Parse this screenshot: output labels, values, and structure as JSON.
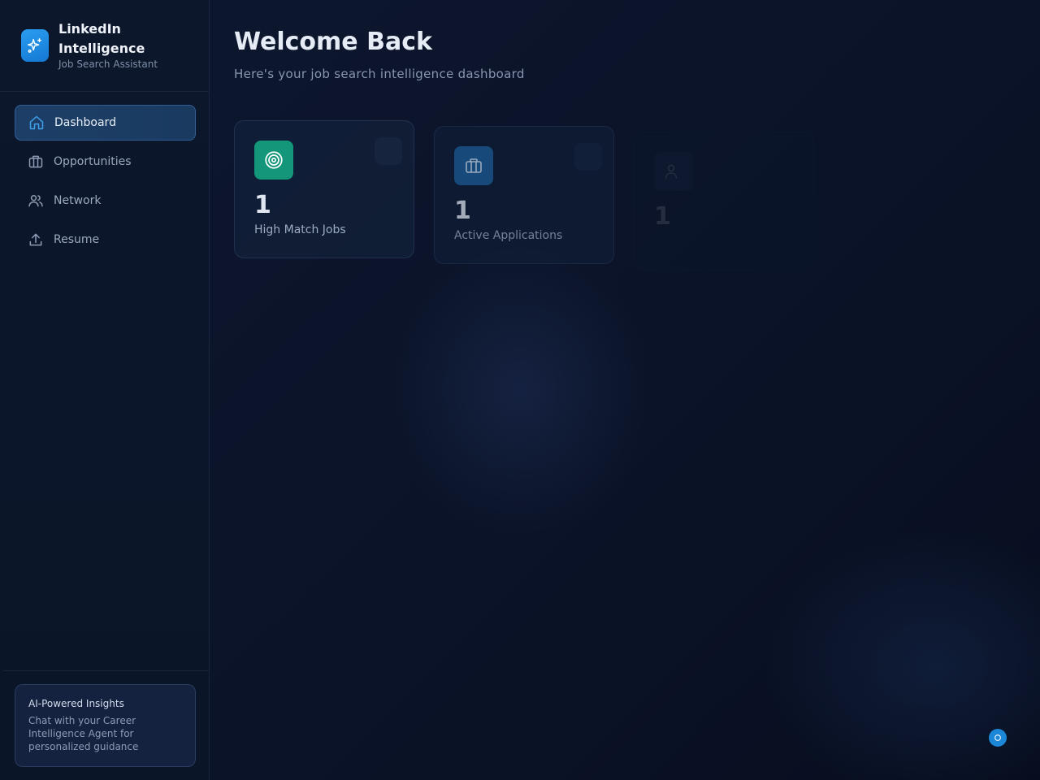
{
  "brand": {
    "title": "LinkedIn Intelligence",
    "subtitle": "Job Search Assistant",
    "icon": "sparkles-icon",
    "color": "#2a9df0"
  },
  "nav": {
    "items": [
      {
        "label": "Dashboard",
        "icon": "home-icon",
        "active": true
      },
      {
        "label": "Opportunities",
        "icon": "briefcase-icon",
        "active": false
      },
      {
        "label": "Network",
        "icon": "users-icon",
        "active": false
      },
      {
        "label": "Resume",
        "icon": "upload-icon",
        "active": false
      }
    ]
  },
  "insights": {
    "title": "AI-Powered Insights",
    "text": "Chat with your Career Intelligence Agent for personalized guidance"
  },
  "main": {
    "title": "Welcome Back",
    "subtitle": "Here's your job search intelligence dashboard"
  },
  "stats": [
    {
      "value": "1",
      "label": "High Match Jobs",
      "icon": "target-icon",
      "color": "#14967a"
    },
    {
      "value": "1",
      "label": "Active Applications",
      "icon": "briefcase-icon",
      "color": "#1c5f99"
    },
    {
      "value": "1",
      "label": "",
      "icon": "users-icon",
      "color": "#2a3a5c"
    }
  ],
  "colors": {
    "background": "#0a1124",
    "active_nav": "#1d3f67",
    "accent": "#1c87d6"
  }
}
